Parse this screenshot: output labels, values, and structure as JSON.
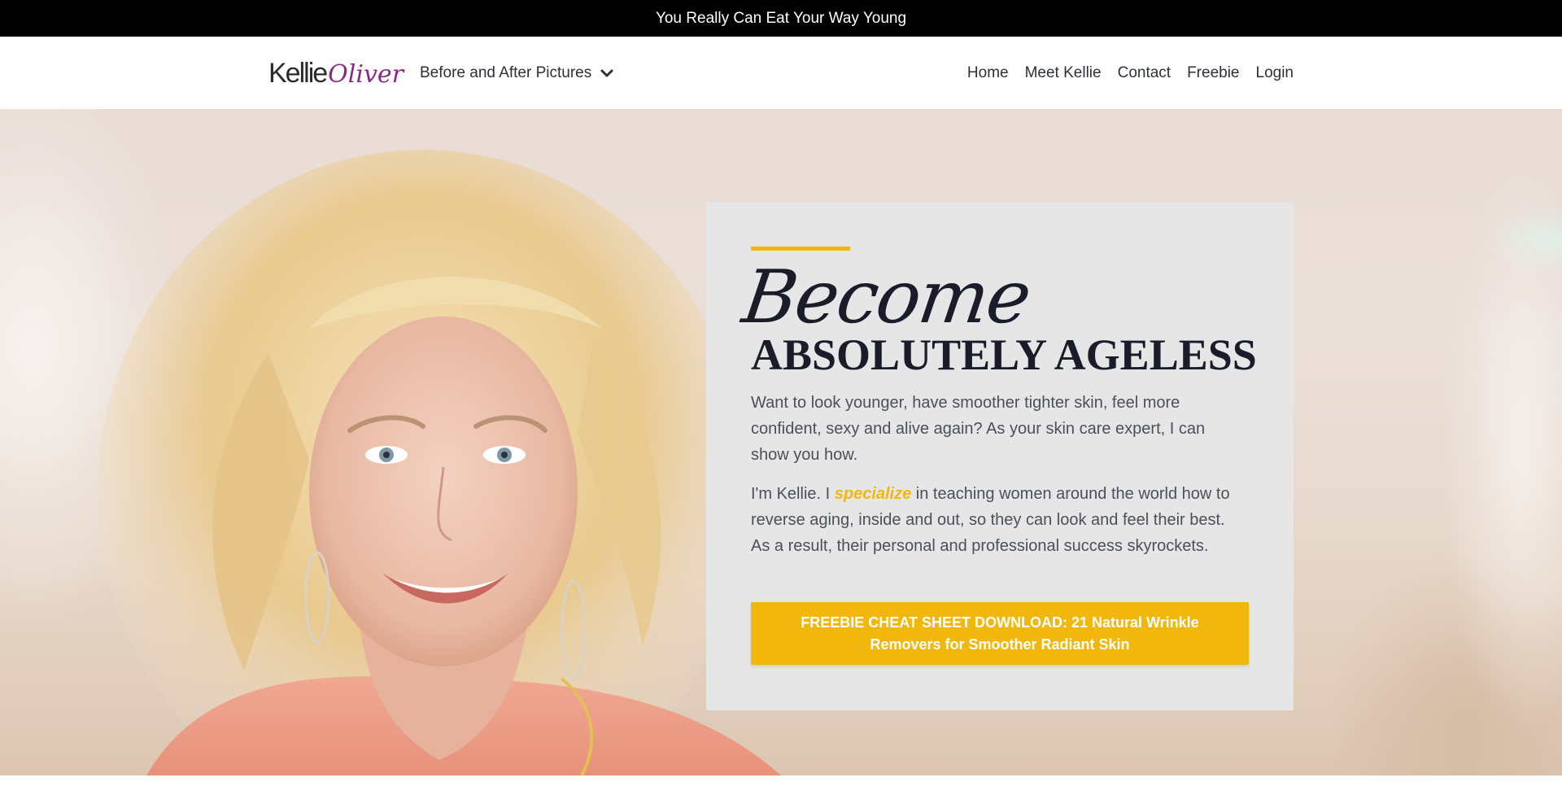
{
  "announcement": {
    "text": "You Really Can Eat Your Way Young"
  },
  "header": {
    "logo": {
      "first": "Kellie",
      "last": "Oliver"
    },
    "dropdown": {
      "label": "Before and After Pictures"
    },
    "nav": [
      {
        "label": "Home"
      },
      {
        "label": "Meet Kellie"
      },
      {
        "label": "Contact"
      },
      {
        "label": "Freebie"
      },
      {
        "label": "Login"
      }
    ]
  },
  "hero": {
    "script_title": "Become",
    "headline": "ABSOLUTELY AGELESS",
    "para1": "Want to look younger, have smoother tighter skin, feel more confident, sexy and alive again?   As your skin care expert, I can show you how.",
    "para2_before": "I'm Kellie. I ",
    "para2_emph": "specialize",
    "para2_after": " in teaching women around the world how to reverse aging, inside and out, so they can look and feel their best.  As a result, their personal and professional success skyrockets.",
    "cta": "FREEBIE CHEAT SHEET DOWNLOAD: 21 Natural Wrinkle Removers for Smoother Radiant Skin"
  },
  "colors": {
    "accent": "#f2b70c",
    "brand_purple": "#8a2a82",
    "top_bar": "#000000",
    "card_bg": "#e6e6e6",
    "heading": "#1b1b2a"
  },
  "icons": {
    "dropdown": "chevron-down-icon"
  }
}
